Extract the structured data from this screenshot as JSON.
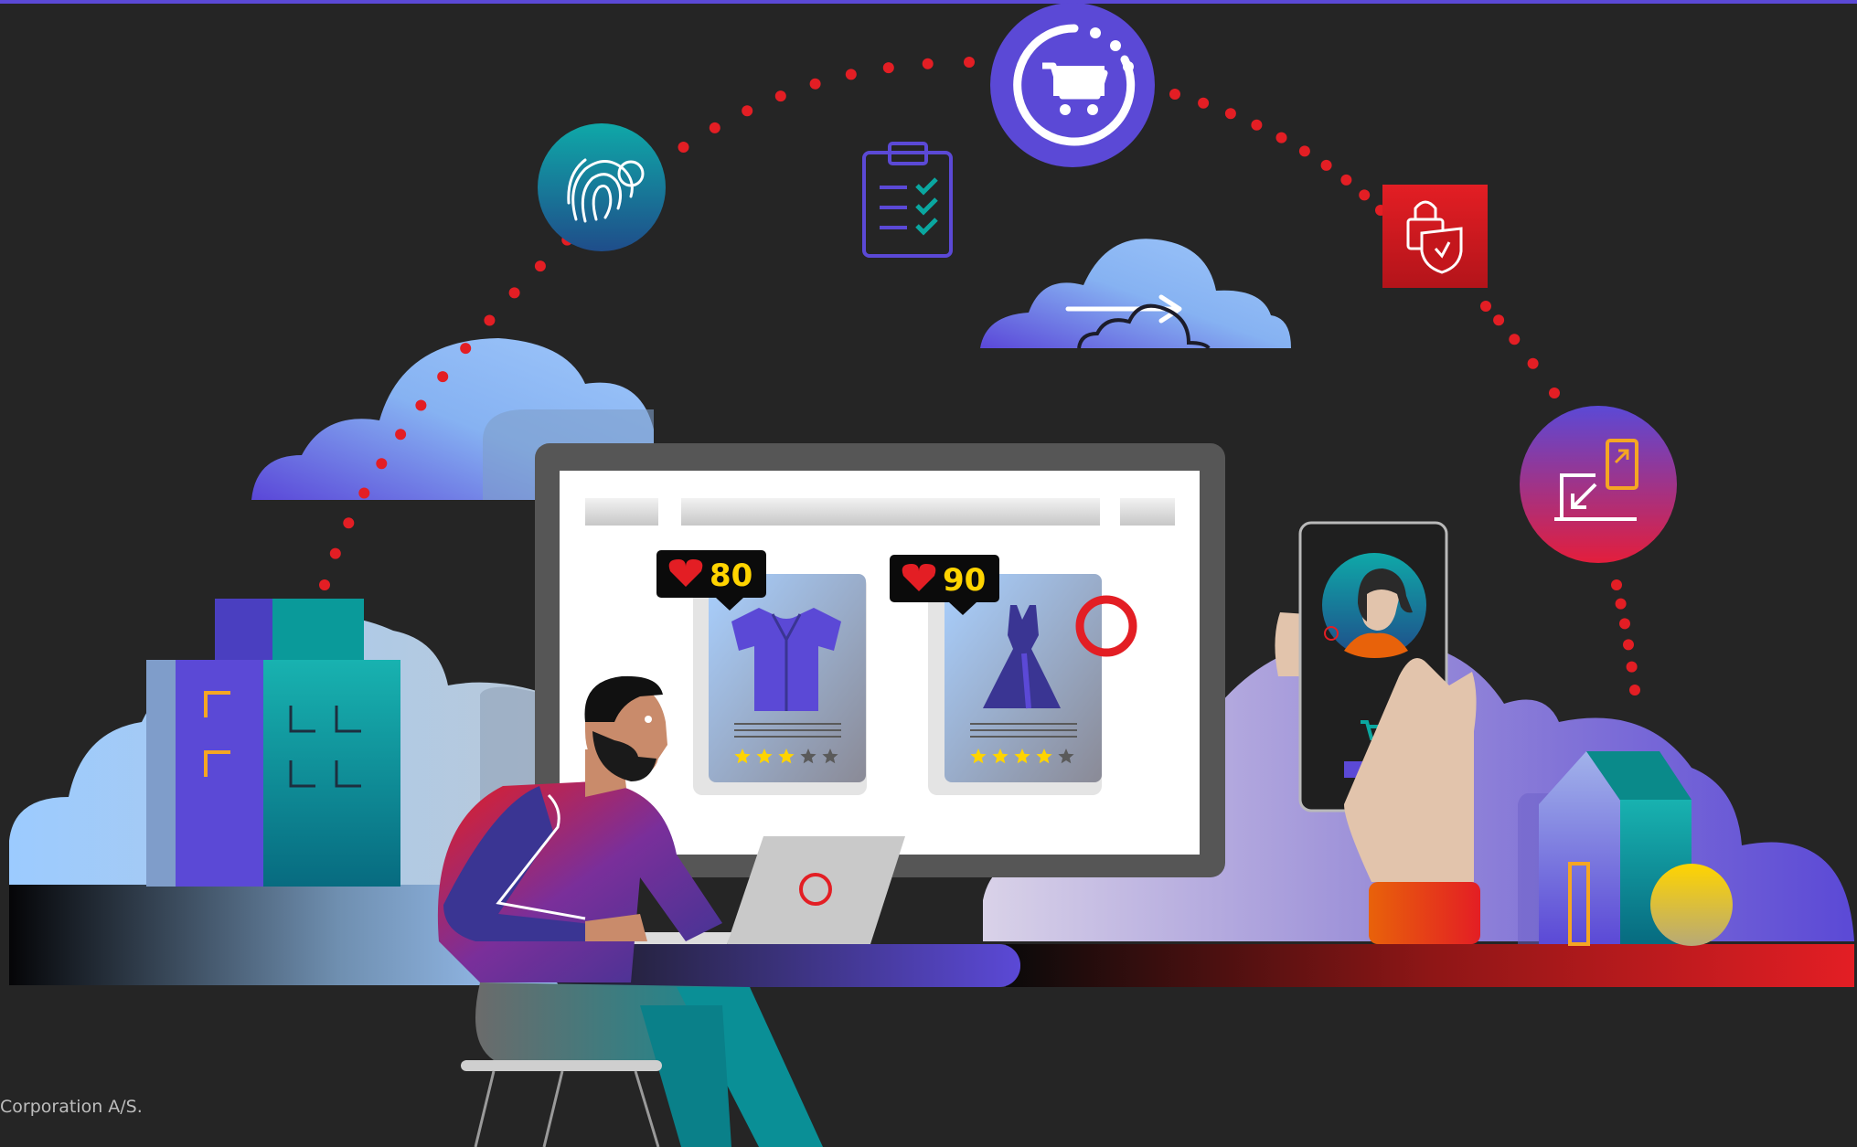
{
  "illustration": {
    "product_cards": [
      {
        "item": "shirt",
        "likes": "80",
        "rating_stars": 3,
        "rating_max": 5
      },
      {
        "item": "dress",
        "likes": "90",
        "rating_stars": 4,
        "rating_max": 5
      }
    ],
    "icons": [
      "fingerprint-icon",
      "clipboard-checklist-icon",
      "cart-refresh-icon",
      "cloud-sync-icon",
      "lock-shield-icon",
      "resize-devices-icon",
      "cart-icon",
      "heart-icon",
      "star-icon"
    ],
    "colors": {
      "background": "#252525",
      "purple": "#5b49d6",
      "teal": "#0a9a9a",
      "red": "#e31e24",
      "yellow": "#ffd400"
    }
  },
  "footer": {
    "copyright": "Corporation A/S."
  }
}
